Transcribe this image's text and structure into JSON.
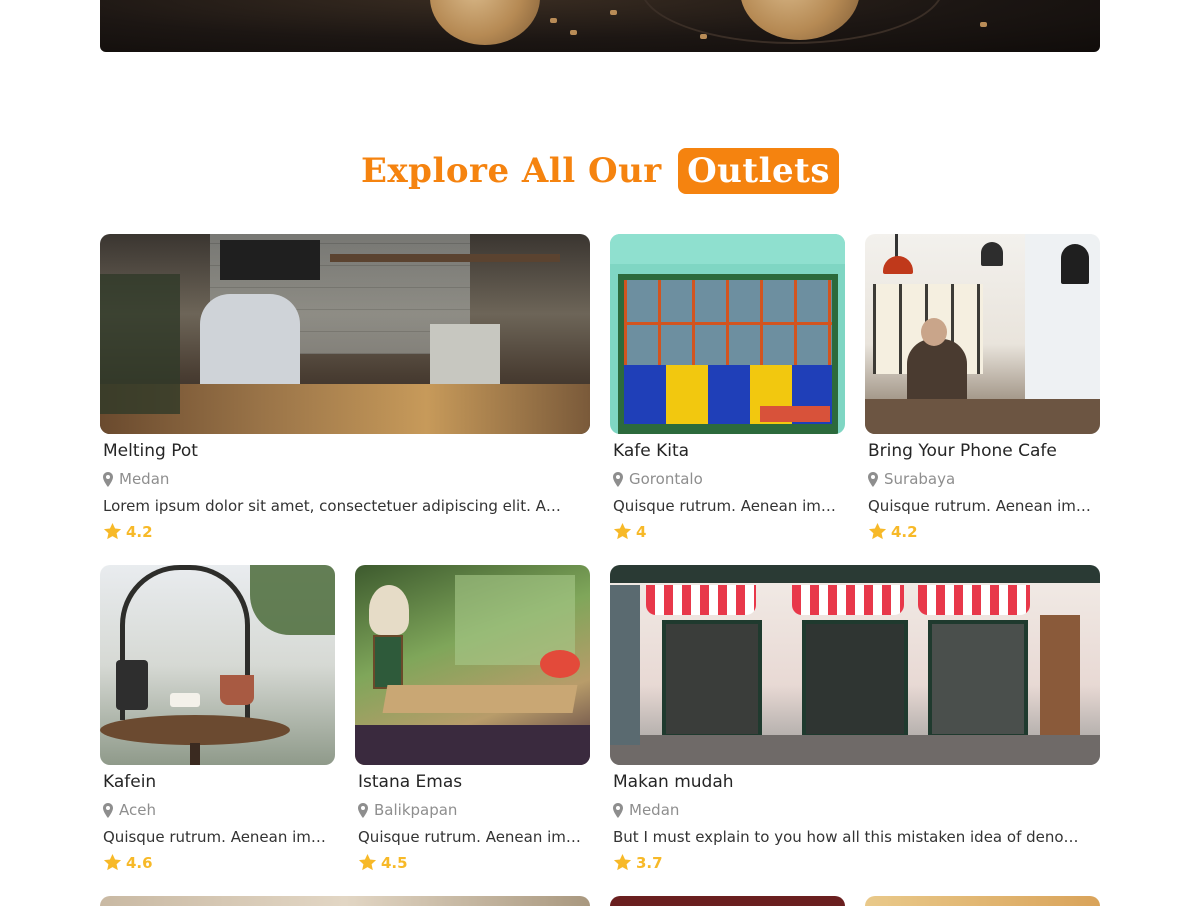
{
  "section": {
    "title": "Explore All Our",
    "title_highlight": "Outlets"
  },
  "outlets": [
    {
      "name": "Melting Pot",
      "location": "Medan",
      "description": "Lorem ipsum dolor sit amet, consectetuer adipiscing elit. A…",
      "rating": "4.2"
    },
    {
      "name": "Kafe Kita",
      "location": "Gorontalo",
      "description": "Quisque rutrum. Aenean im…",
      "rating": "4"
    },
    {
      "name": "Bring Your Phone Cafe",
      "location": "Surabaya",
      "description": "Quisque rutrum. Aenean im…",
      "rating": "4.2"
    },
    {
      "name": "Kafein",
      "location": "Aceh",
      "description": "Quisque rutrum. Aenean im…",
      "rating": "4.6"
    },
    {
      "name": "Istana Emas",
      "location": "Balikpapan",
      "description": "Quisque rutrum. Aenean im…",
      "rating": "4.5"
    },
    {
      "name": "Makan mudah",
      "location": "Medan",
      "description": "But I must explain to you how all this mistaken idea of deno…",
      "rating": "3.7"
    }
  ],
  "icons": {
    "location": "map-pin-icon",
    "rating": "star-icon"
  },
  "colors": {
    "accent": "#f5830f",
    "star": "#f7b928",
    "muted": "#8e8e8e"
  }
}
